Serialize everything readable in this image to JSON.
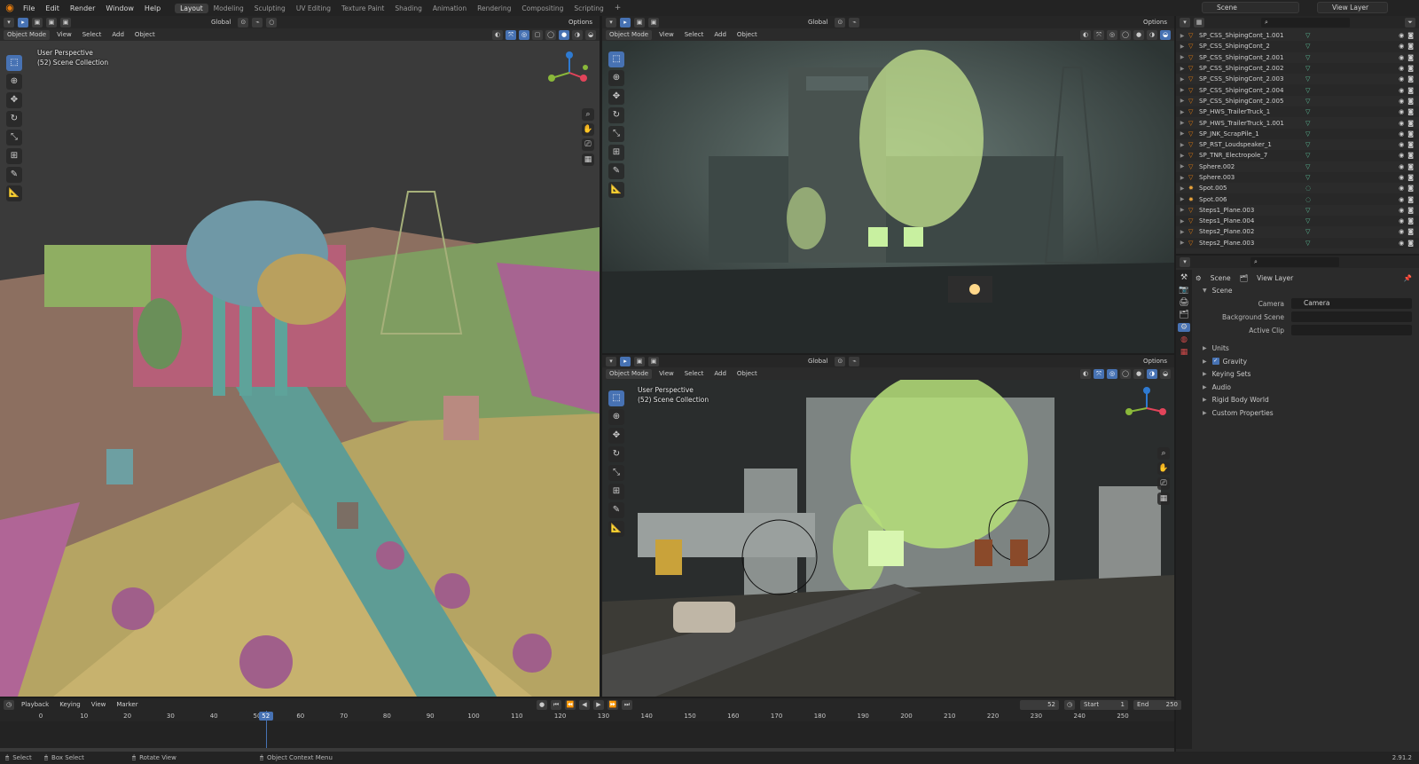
{
  "top_menu": [
    "File",
    "Edit",
    "Render",
    "Window",
    "Help"
  ],
  "workspaces": [
    "Layout",
    "Modeling",
    "Sculpting",
    "UV Editing",
    "Texture Paint",
    "Shading",
    "Animation",
    "Rendering",
    "Compositing",
    "Scripting"
  ],
  "active_workspace": "Layout",
  "scene_name": "Scene",
  "view_layer_name": "View Layer",
  "viewport_left": {
    "mode": "Object Mode",
    "menus": [
      "View",
      "Select",
      "Add",
      "Object"
    ],
    "transform": "Global",
    "options": "Options",
    "perspective": "User Perspective",
    "collection": "(52) Scene Collection"
  },
  "viewport_top_right": {
    "mode": "Object Mode",
    "menus": [
      "View",
      "Select",
      "Add",
      "Object"
    ],
    "transform": "Global",
    "options": "Options"
  },
  "viewport_bottom_right": {
    "mode": "Object Mode",
    "menus": [
      "View",
      "Select",
      "Add",
      "Object"
    ],
    "transform": "Global",
    "options": "Options",
    "perspective": "User Perspective",
    "collection": "(52) Scene Collection"
  },
  "outliner": [
    "SP_CSS_ShipingCont_1.001",
    "SP_CSS_ShipingCont_2",
    "SP_CSS_ShipingCont_2.001",
    "SP_CSS_ShipingCont_2.002",
    "SP_CSS_ShipingCont_2.003",
    "SP_CSS_ShipingCont_2.004",
    "SP_CSS_ShipingCont_2.005",
    "SP_HWS_TrailerTruck_1",
    "SP_HWS_TrailerTruck_1.001",
    "SP_JNK_ScrapPile_1",
    "SP_RST_Loudspeaker_1",
    "SP_TNR_Electropole_7",
    "Sphere.002",
    "Sphere.003",
    "Spot.005",
    "Spot.006",
    "Steps1_Plane.003",
    "Steps1_Plane.004",
    "Steps2_Plane.002",
    "Steps2_Plane.003"
  ],
  "properties": {
    "tab_scene": "Scene",
    "tab_view_layer": "View Layer",
    "section_scene": "Scene",
    "camera_label": "Camera",
    "camera_value": "Camera",
    "background_label": "Background Scene",
    "active_clip_label": "Active Clip",
    "sections": [
      "Units",
      "Gravity",
      "Keying Sets",
      "Audio",
      "Rigid Body World",
      "Custom Properties"
    ]
  },
  "timeline": {
    "menus": [
      "Playback",
      "Keying",
      "View",
      "Marker"
    ],
    "current_frame": "52",
    "start_label": "Start",
    "start_value": "1",
    "end_label": "End",
    "end_value": "250",
    "ticks": [
      "0",
      "10",
      "20",
      "30",
      "40",
      "50",
      "60",
      "70",
      "80",
      "90",
      "100",
      "110",
      "120",
      "130",
      "140",
      "150",
      "160",
      "170",
      "180",
      "190",
      "200",
      "210",
      "220",
      "230",
      "240",
      "250"
    ]
  },
  "status_bar": {
    "select": "Select",
    "box_select": "Box Select",
    "rotate": "Rotate View",
    "context": "Object Context Menu",
    "version": "2.91.2"
  }
}
